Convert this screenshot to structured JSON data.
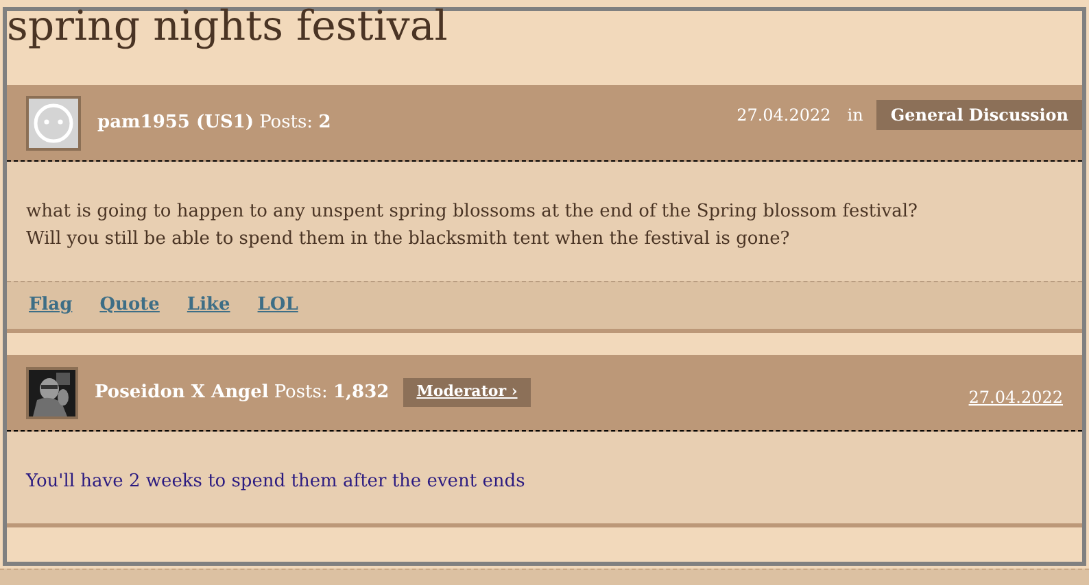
{
  "thread": {
    "title": "spring nights festival"
  },
  "posts": [
    {
      "kind": "member",
      "author": "pam1955 (US1)",
      "posts_label": "Posts:",
      "posts_count": "2",
      "date": "27.04.2022",
      "date_link": false,
      "in_label": "in",
      "category": "General Discussion",
      "body": [
        "what is going to happen to any unspent spring blossoms at the end of the Spring blossom festival?",
        "Will you still be able to spend them in the blacksmith tent when the festival is gone?"
      ],
      "actions": [
        "Flag",
        "Quote",
        "Like",
        "LOL"
      ]
    },
    {
      "kind": "moderator",
      "author": "Poseidon X Angel",
      "posts_label": "Posts:",
      "posts_count": "1,832",
      "badge": "Moderator ›",
      "date": "27.04.2022",
      "date_link": true,
      "body": [
        "You'll have 2 weeks to spend them after the event ends"
      ]
    }
  ]
}
